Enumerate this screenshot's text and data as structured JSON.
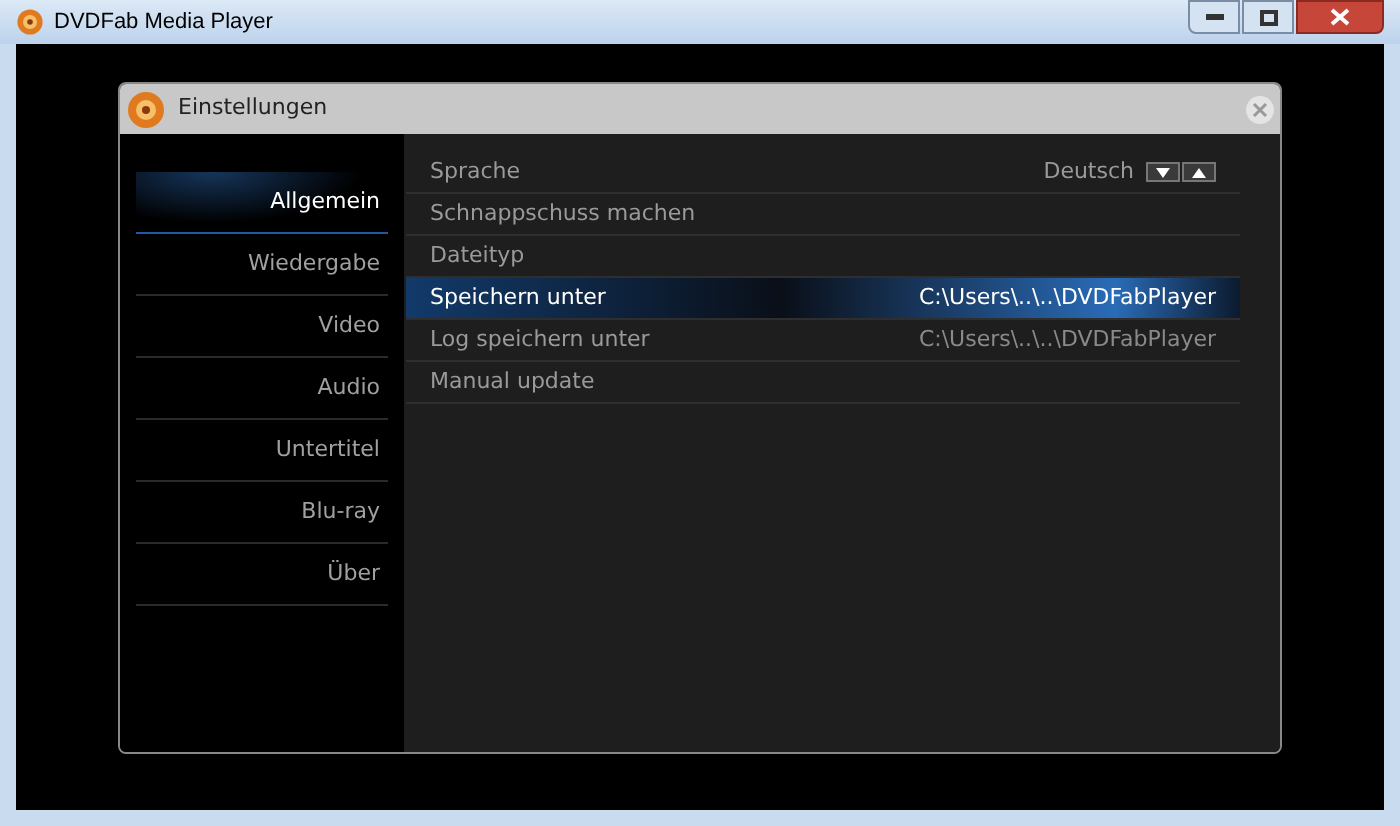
{
  "window": {
    "title": "DVDFab Media Player"
  },
  "dialog": {
    "title": "Einstellungen"
  },
  "sidebar": {
    "items": [
      {
        "label": "Allgemein",
        "selected": true
      },
      {
        "label": "Wiedergabe",
        "selected": false
      },
      {
        "label": "Video",
        "selected": false
      },
      {
        "label": "Audio",
        "selected": false
      },
      {
        "label": "Untertitel",
        "selected": false
      },
      {
        "label": "Blu-ray",
        "selected": false
      },
      {
        "label": "Über",
        "selected": false
      }
    ]
  },
  "settings": [
    {
      "label": "Sprache",
      "kind": "spinner",
      "value": "Deutsch",
      "selected": false
    },
    {
      "label": "Schnappschuss machen",
      "kind": "plain",
      "selected": false
    },
    {
      "label": "Dateityp",
      "kind": "plain",
      "selected": false
    },
    {
      "label": "Speichern unter",
      "kind": "path",
      "value": "C:\\Users\\..\\..\\DVDFabPlayer",
      "selected": true
    },
    {
      "label": "Log speichern unter",
      "kind": "path",
      "value": "C:\\Users\\..\\..\\DVDFabPlayer",
      "selected": false
    },
    {
      "label": "Manual update",
      "kind": "plain",
      "selected": false
    }
  ]
}
